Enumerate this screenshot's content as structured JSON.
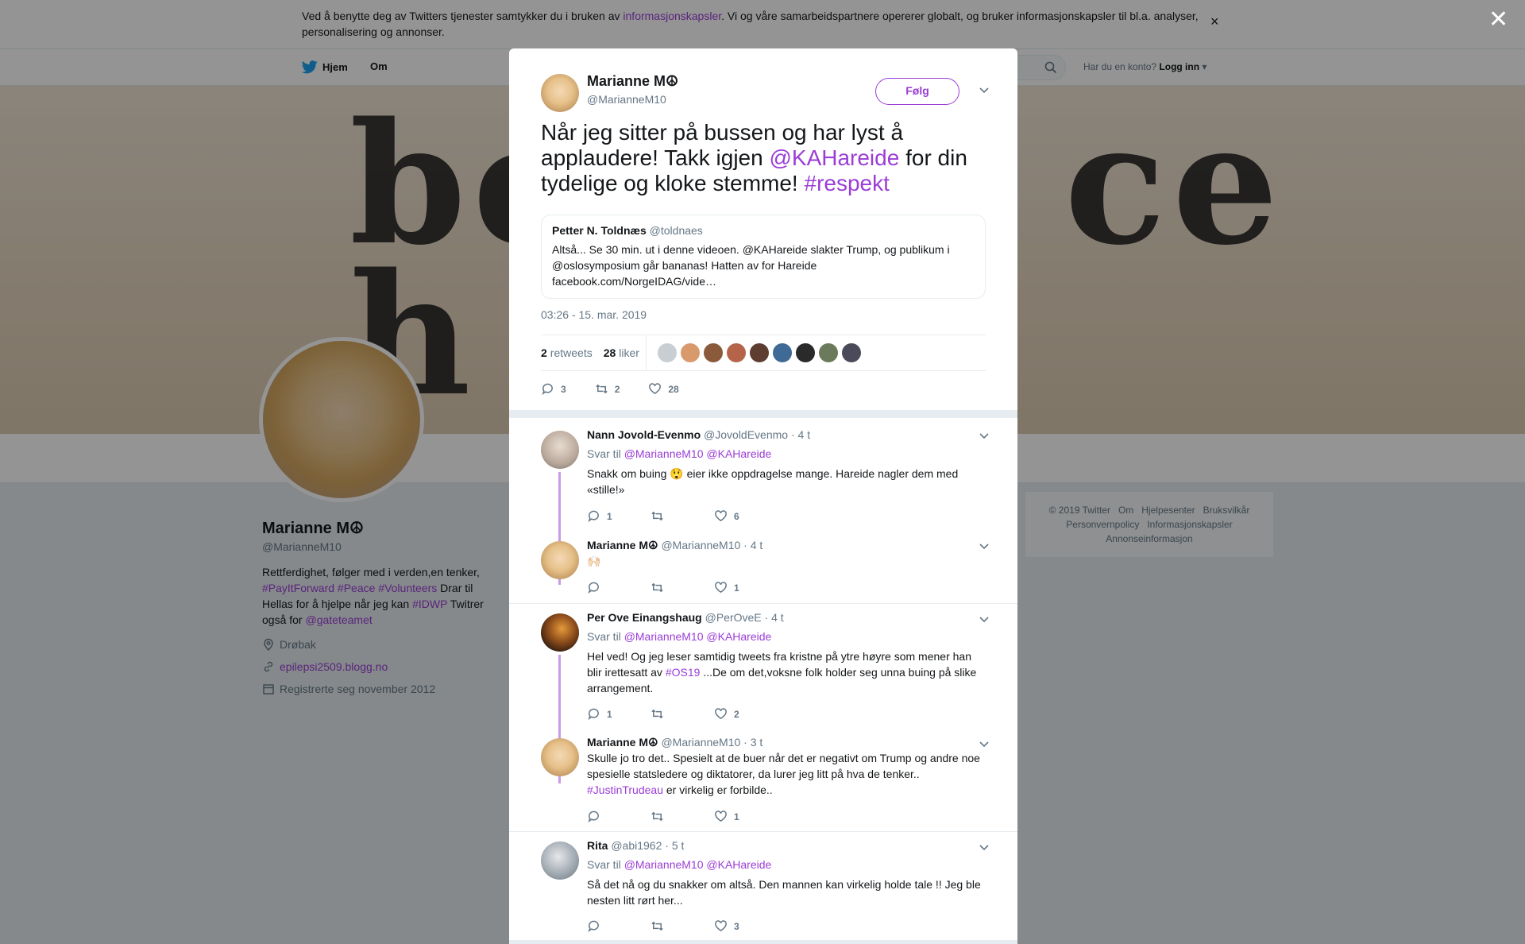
{
  "cookie": {
    "text_before": "Ved å benytte deg av Twitters tjenester samtykker du i bruken av ",
    "link": "informasjonskapsler",
    "text_after": ". Vi og våre samarbeidspartnere opererer globalt, og bruker informasjonskapsler til bl.a. analyser, personalisering og annonser.",
    "close": "×"
  },
  "nav": {
    "home": "Hjem",
    "about": "Om",
    "account_q": "Har du en konto?",
    "login": "Logg inn"
  },
  "banner": {
    "line1a": "be",
    "line1b": "ce",
    "line2": "h"
  },
  "profile": {
    "name": "Marianne M☮",
    "handle": "@MarianneM10",
    "bio_1": "Rettferdighet, følger med i verden,en tenker,",
    "bio_tags": "#PayItForward #Peace #Volunteers",
    "bio_2": " Drar til Hellas for å hjelpe når jeg kan ",
    "bio_tag2": "#IDWP",
    "bio_3": " Twitrer også for ",
    "bio_mention": "@gateteamet",
    "location": "Drøbak",
    "website": "epilepsi2509.blogg.no",
    "joined": "Registrerte seg november 2012"
  },
  "footer": {
    "items_row1": [
      "© 2019 Twitter",
      "Om",
      "Hjelpesenter",
      "Bruksvilkår"
    ],
    "items_row2": [
      "Personvernpolicy",
      "Informasjonskapsler"
    ],
    "items_row3": [
      "Annonseinformasjon"
    ]
  },
  "modal_close": "✕",
  "tweet": {
    "name": "Marianne M☮",
    "handle": "@MarianneM10",
    "follow": "Følg",
    "text_1": "Når jeg sitter på bussen og har lyst å applaudere! Takk igjen ",
    "mention": "@KAHareide",
    "text_2": " for din tydelige og kloke stemme! ",
    "hashtag": "#respekt",
    "quote": {
      "name": "Petter N. Toldnæs",
      "handle": "@toldnaes",
      "text": "Altså... Se 30 min. ut i denne videoen. @KAHareide slakter Trump, og publikum i @oslosymposium går bananas! Hatten av for Hareide facebook.com/NorgeIDAG/vide…"
    },
    "date": "03:26 - 15. mar. 2019",
    "retweets_n": "2",
    "retweets_label": "retweets",
    "likes_n": "28",
    "likes_label": "liker",
    "actions": {
      "reply": "3",
      "retweet": "2",
      "like": "28"
    }
  },
  "replies": [
    {
      "name": "Nann Jovold-Evenmo",
      "handle": "@JovoldEvenmo",
      "time": "· 4 t",
      "svar_label": "Svar til",
      "svar_to": "@MarianneM10 @KAHareide",
      "text": "Snakk om buing 😲 eier ikke oppdragelse mange. Hareide nagler dem med «stille!»",
      "reply": "1",
      "retweet": "",
      "like": "6"
    },
    {
      "name": "Marianne M☮",
      "handle": "@MarianneM10",
      "time": "· 4 t",
      "text": "🙌🏻",
      "reply": "",
      "retweet": "",
      "like": "1"
    },
    {
      "name": "Per Ove Einangshaug",
      "handle": "@PerOveE",
      "time": "· 4 t",
      "svar_label": "Svar til",
      "svar_to": "@MarianneM10 @KAHareide",
      "text_1": "Hel ved! Og jeg leser samtidig tweets fra kristne på ytre høyre som mener han blir irettesatt av ",
      "tag": "#OS19",
      "text_2": " ...De om det,voksne folk holder seg unna buing på slike arrangement.",
      "reply": "1",
      "retweet": "",
      "like": "2"
    },
    {
      "name": "Marianne M☮",
      "handle": "@MarianneM10",
      "time": "· 3 t",
      "text_1": "Skulle jo tro det.. Spesielt at de buer når det er negativt om Trump og andre noe spesielle statsledere og diktatorer, da lurer jeg litt på hva de tenker.. ",
      "tag": "#JustinTrudeau",
      "text_2": " er virkelig er forbilde..",
      "reply": "",
      "retweet": "",
      "like": "1"
    },
    {
      "name": "Rita",
      "handle": "@abi1962",
      "time": "· 5 t",
      "svar_label": "Svar til",
      "svar_to": "@MarianneM10 @KAHareide",
      "text": "Så det nå og du snakker om altså. Den mannen kan virkelig holde tale !! Jeg ble nesten litt rørt her...",
      "reply": "",
      "retweet": "",
      "like": "3"
    }
  ],
  "colors": {
    "accent": "#9b3dd6",
    "thread_line": "#c89be6",
    "muted": "#657786",
    "overlay": "rgba(0,0,0,0.42)"
  },
  "icons": [
    "twitter-bird-icon",
    "search-icon",
    "location-icon",
    "link-icon",
    "calendar-icon",
    "reply-icon",
    "retweet-icon",
    "heart-icon",
    "chevron-down-icon",
    "close-icon"
  ]
}
